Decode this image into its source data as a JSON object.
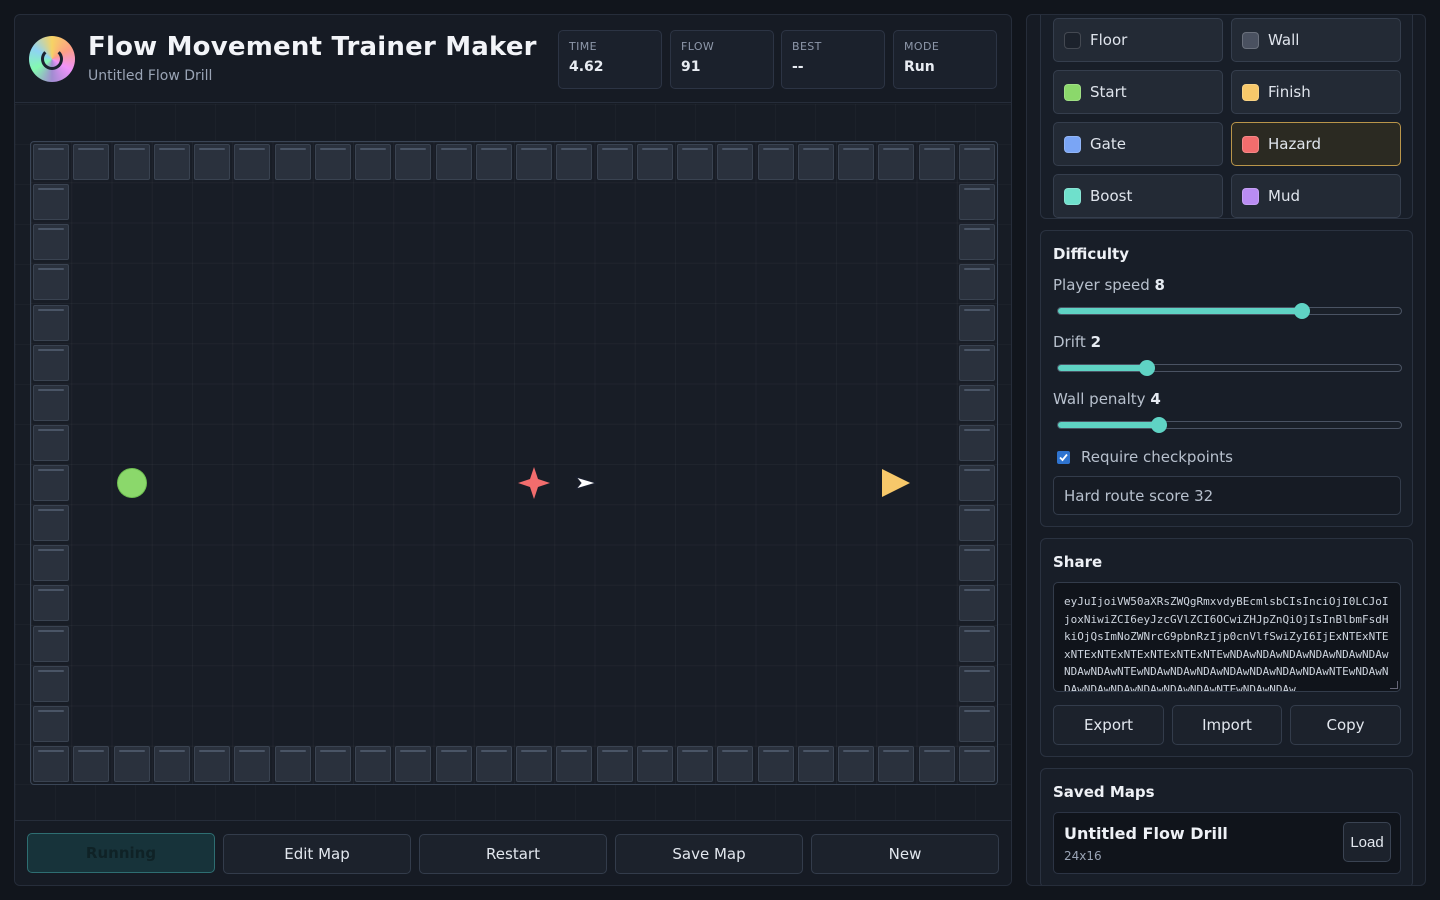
{
  "app": {
    "title": "Flow Movement Trainer Maker",
    "subtitle": "Untitled Flow Drill"
  },
  "stats": [
    {
      "label": "TIME",
      "value": "4.62"
    },
    {
      "label": "FLOW",
      "value": "91"
    },
    {
      "label": "BEST",
      "value": "--"
    },
    {
      "label": "MODE",
      "value": "Run"
    }
  ],
  "board": {
    "cols": 24,
    "rows": 16,
    "start": {
      "col": 2,
      "row": 8
    },
    "hazard": {
      "col": 12,
      "row": 8
    },
    "finish": {
      "col": 21,
      "row": 8
    },
    "player": {
      "col": 13.3,
      "row": 8
    }
  },
  "actions": {
    "running": "Running",
    "edit_map": "Edit Map",
    "restart": "Restart",
    "save_map": "Save Map",
    "new": "New"
  },
  "palette": {
    "items": [
      {
        "label": "Floor",
        "color": "#1c222c",
        "selected": false
      },
      {
        "label": "Wall",
        "color": "#4a5160",
        "selected": false
      },
      {
        "label": "Start",
        "color": "#8bd86b",
        "selected": false
      },
      {
        "label": "Finish",
        "color": "#f7c86a",
        "selected": false
      },
      {
        "label": "Gate",
        "color": "#7aa5f5",
        "selected": false
      },
      {
        "label": "Hazard",
        "color": "#f26d6d",
        "selected": true
      },
      {
        "label": "Boost",
        "color": "#6fe0cc",
        "selected": false
      },
      {
        "label": "Mud",
        "color": "#b98cf2",
        "selected": false
      }
    ]
  },
  "difficulty": {
    "title": "Difficulty",
    "sliders": [
      {
        "label": "Player speed",
        "value": "8",
        "fraction": 0.71
      },
      {
        "label": "Drift",
        "value": "2",
        "fraction": 0.26
      },
      {
        "label": "Wall penalty",
        "value": "4",
        "fraction": 0.295
      }
    ],
    "require_checkpoints": {
      "label": "Require checkpoints",
      "checked": true
    },
    "score_text": "Hard route score 32"
  },
  "share": {
    "title": "Share",
    "code": "eyJuIjoiVW50aXRsZWQgRmxvdyBEcmlsbCIsInciOjI0LCJoIjoxNiwiZCI6eyJzcGVlZCI6OCwiZHJpZnQiOjIsInBlbmFsdHkiOjQsImNoZWNrcG9pbnRzIjp0cnVlfSwiZyI6IjExNTExNTExNTExNTExNTExNTExNTExNTEwNDAwNDAwNDAwNDAwNDAwNDAwNDAwNDAwNTEwNDAwNDAwNDAwNDAwNDAwNDAwNDAwNTEwNDAwNDAwNDAwNDAwNDAwNDAwNDAwNTEwNDAwNDAw",
    "buttons": {
      "export": "Export",
      "import": "Import",
      "copy": "Copy"
    }
  },
  "saved": {
    "title": "Saved Maps",
    "items": [
      {
        "name": "Untitled Flow Drill",
        "size": "24x16",
        "load_label": "Load"
      }
    ]
  }
}
